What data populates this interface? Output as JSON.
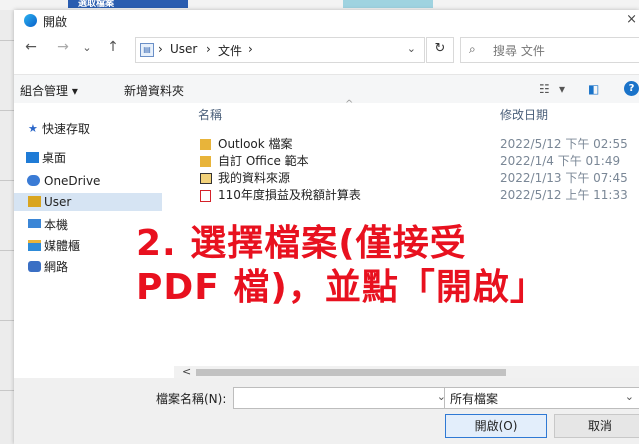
{
  "background": {
    "top_tab_label": "選取檔案"
  },
  "window": {
    "title": "開啟",
    "close_glyph": "×"
  },
  "nav_buttons": {
    "back": "←",
    "forward": "→",
    "recent": "⌄",
    "up": "↑"
  },
  "address": {
    "breadcrumb": [
      "User",
      "文件"
    ],
    "separator": "›",
    "dropdown": "⌄",
    "refresh": "↻"
  },
  "search": {
    "icon": "⌕",
    "placeholder": "搜尋 文件"
  },
  "toolbar": {
    "organize": "組合管理 ▾",
    "new_folder": "新增資料夾",
    "view": "▾",
    "help": "?"
  },
  "sidebar": {
    "items": [
      {
        "label": "快速存取",
        "icon": "pin-icon",
        "color": "#2a66c8"
      },
      {
        "label": "桌面",
        "icon": "desktop-icon",
        "color": "#1f7bd6"
      },
      {
        "label": "OneDrive",
        "icon": "cloud-icon",
        "color": "#3a7bd5"
      },
      {
        "label": "User",
        "icon": "user-folder-icon",
        "color": "#d9a520"
      },
      {
        "label": "本機",
        "icon": "computer-icon",
        "color": "#3b86d6"
      },
      {
        "label": "媒體櫃",
        "icon": "library-icon",
        "color": "#2e8bd8"
      },
      {
        "label": "網路",
        "icon": "network-icon",
        "color": "#3a6fc4"
      }
    ]
  },
  "file_list": {
    "columns": [
      "名稱",
      "修改日期"
    ],
    "sort_caret": "^",
    "rows": [
      {
        "name": "Outlook 檔案",
        "date": "2022/5/12 下午 02:55",
        "icon": "folder-icon"
      },
      {
        "name": "自訂 Office 範本",
        "date": "2022/1/4 下午 01:49",
        "icon": "folder-icon"
      },
      {
        "name": "我的資料來源",
        "date": "2022/1/13 下午 07:45",
        "icon": "data-source-icon"
      },
      {
        "name": "110年度損益及稅額計算表",
        "date": "2022/5/12 上午 11:33",
        "icon": "pdf-icon"
      }
    ]
  },
  "scrollbar": {
    "left_arrow": "<"
  },
  "footer": {
    "filename_label": "檔案名稱(N):",
    "filename_value": "",
    "filter": "所有檔案",
    "open_button": "開啟(O)",
    "cancel_button": "取消"
  },
  "annotation": {
    "line1": "2. 選擇檔案(僅接受",
    "line2": "PDF 檔)，並點「開啟」",
    "color": "#e8111f"
  }
}
